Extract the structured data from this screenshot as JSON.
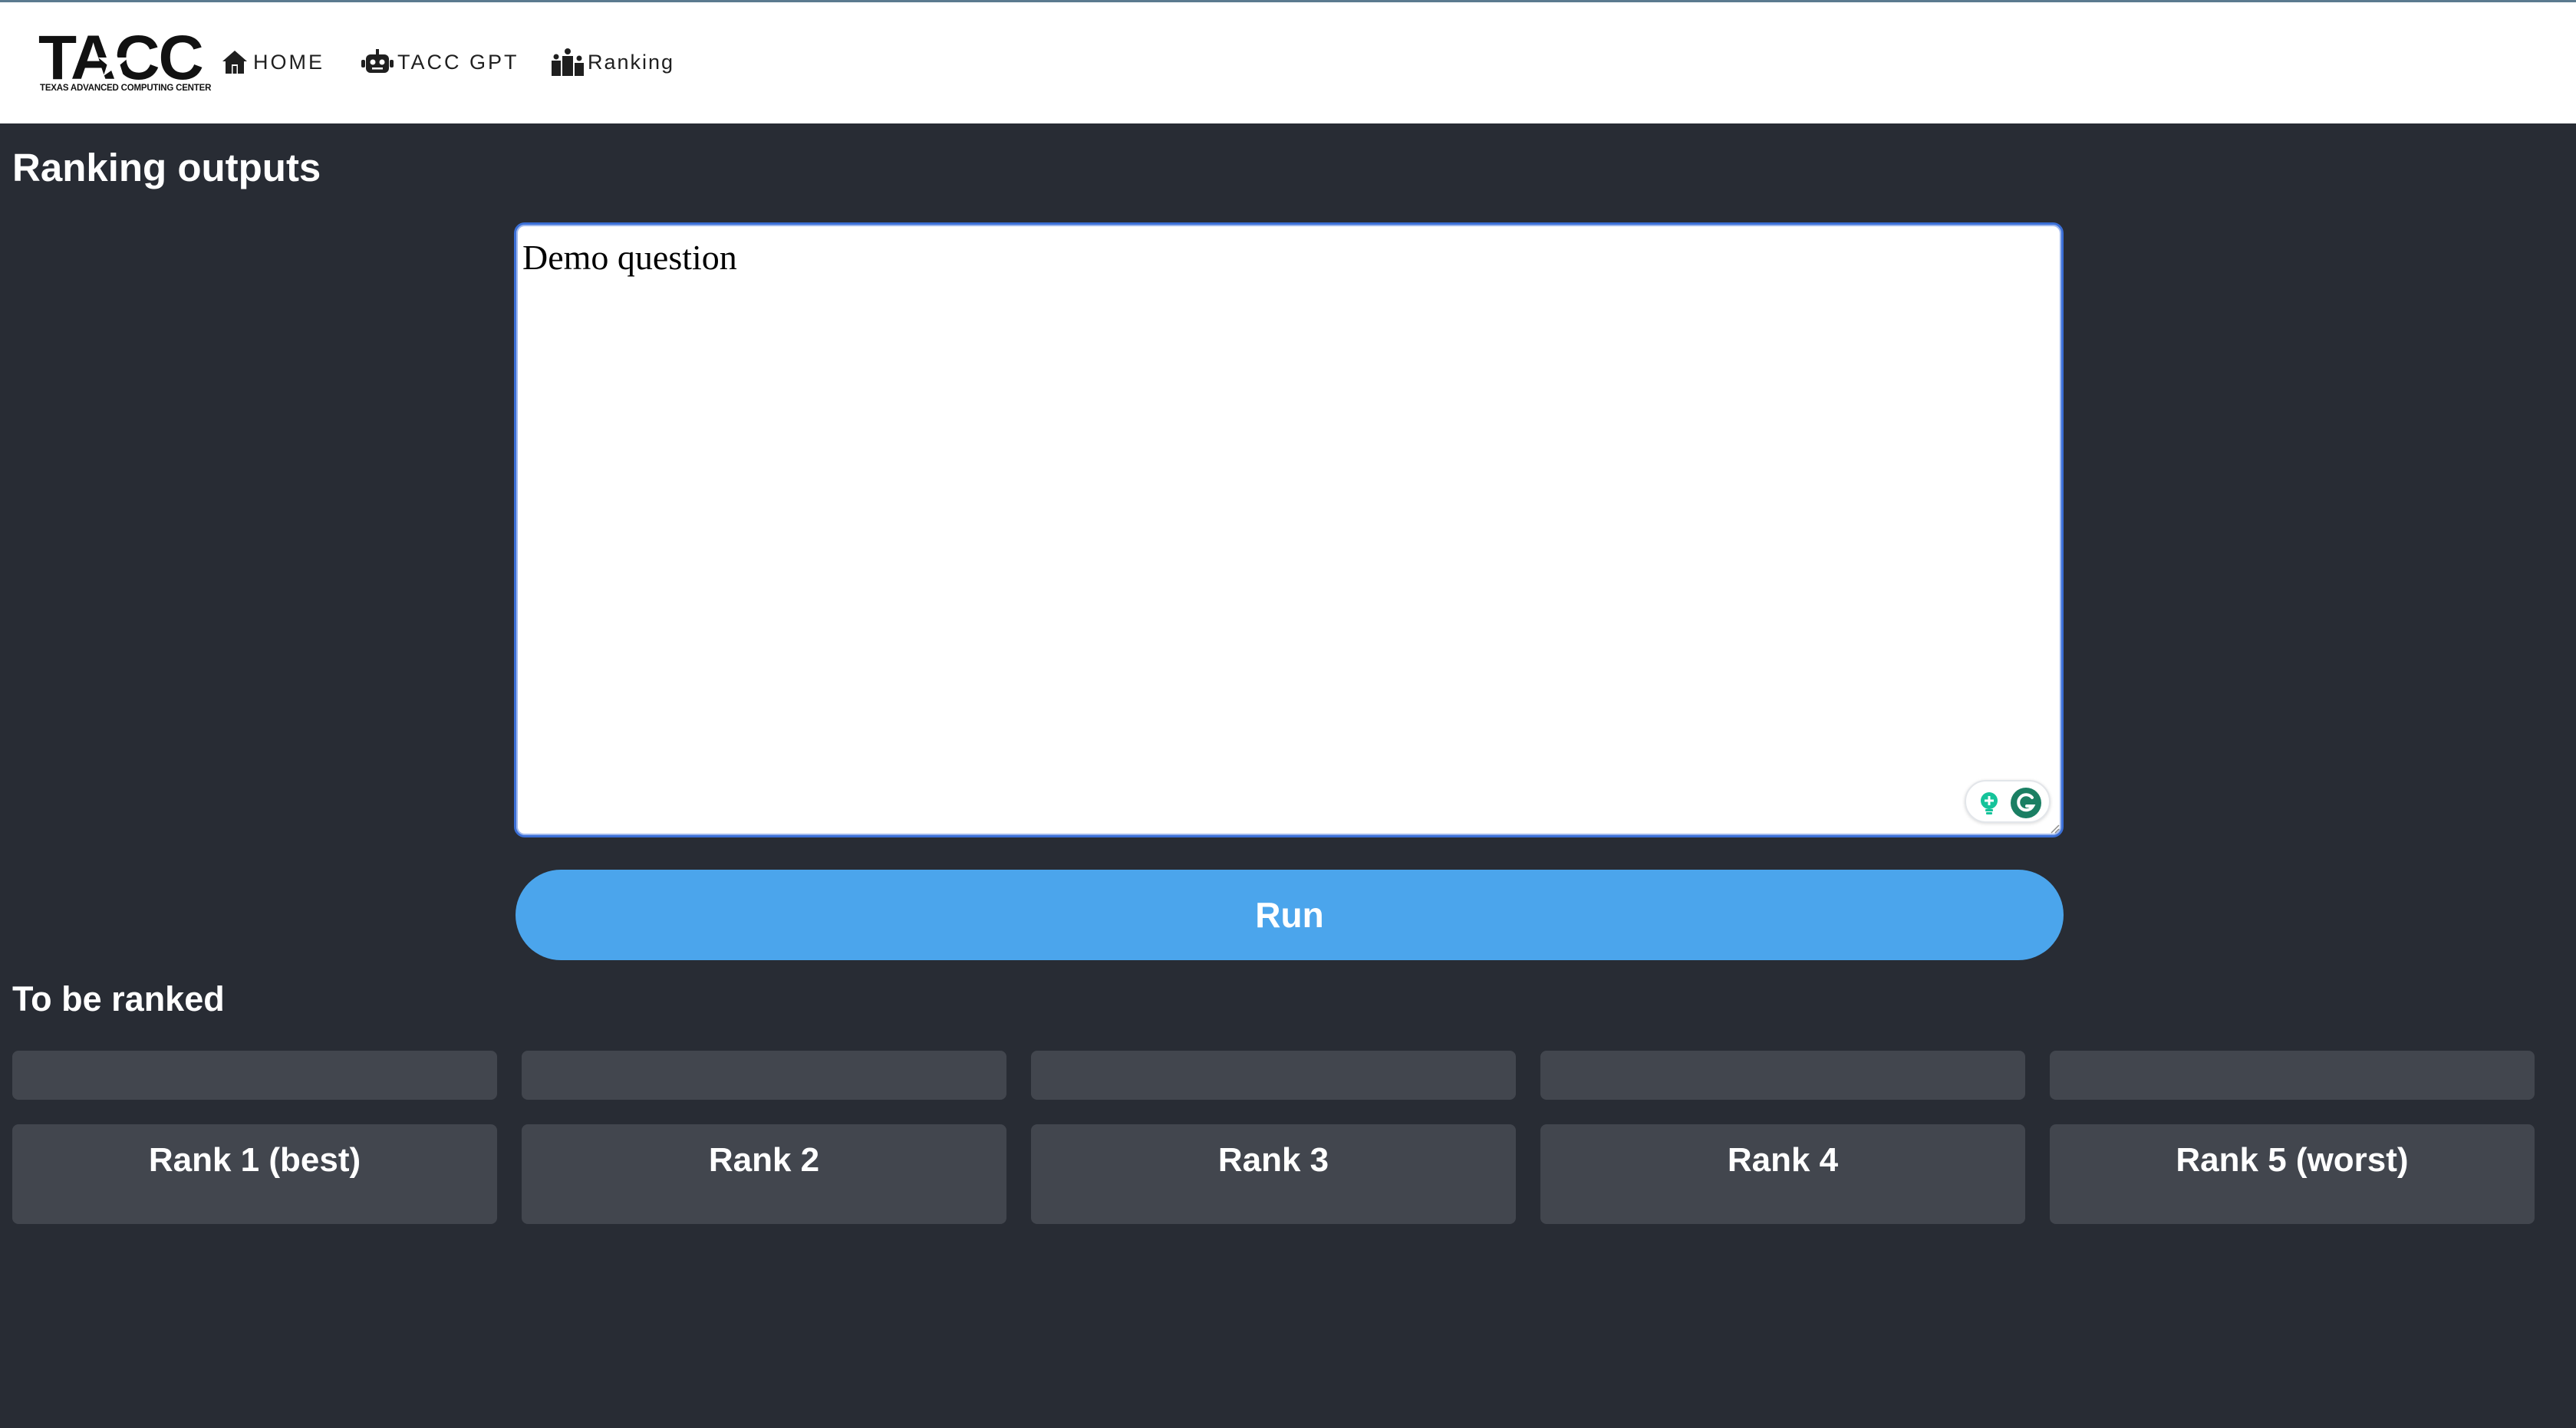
{
  "nav": {
    "logo_text": "TACC",
    "logo_subtitle": "TEXAS ADVANCED COMPUTING CENTER",
    "items": [
      {
        "label": "HOME",
        "icon": "home-icon"
      },
      {
        "label": "TACC GPT",
        "icon": "robot-icon"
      },
      {
        "label": "Ranking",
        "icon": "podium-icon"
      }
    ]
  },
  "page": {
    "title": "Ranking outputs"
  },
  "question": {
    "value": "Demo question"
  },
  "run_button": {
    "label": "Run"
  },
  "ranking": {
    "title": "To be ranked",
    "slots": [
      "",
      "",
      "",
      "",
      ""
    ],
    "ranks": [
      "Rank 1 (best)",
      "Rank 2",
      "Rank 3",
      "Rank 4",
      "Rank 5 (worst)"
    ]
  },
  "colors": {
    "background": "#282c34",
    "navbar": "#ffffff",
    "accent": "#4ba5ec",
    "panel": "#42464e",
    "input_border": "#3b6fd6",
    "grammarly_green": "#15c39a"
  }
}
